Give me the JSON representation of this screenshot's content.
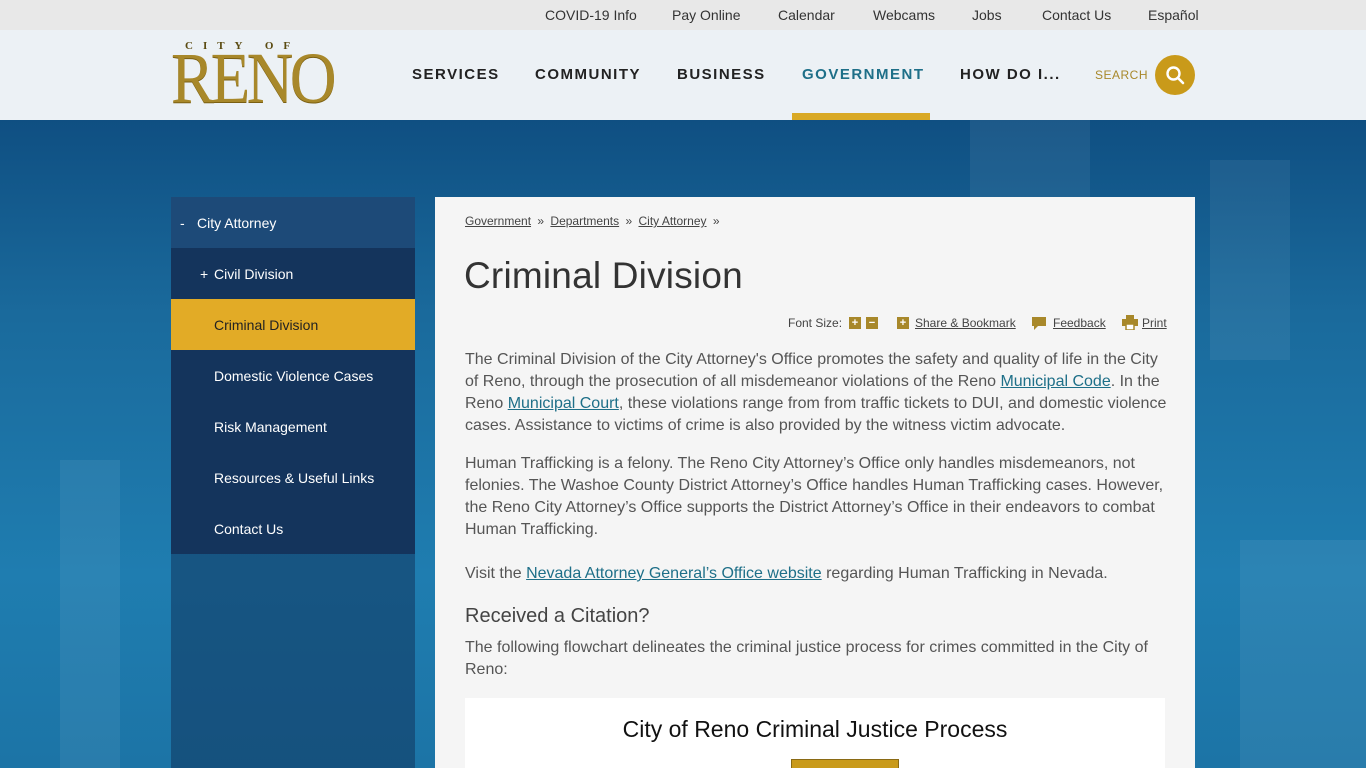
{
  "utility_links": [
    "COVID-19 Info",
    "Pay Online",
    "Calendar",
    "Webcams",
    "Jobs",
    "Contact Us",
    "Español"
  ],
  "logo": {
    "city_of": "CITY OF",
    "name": "RENO"
  },
  "nav": [
    {
      "label": "SERVICES"
    },
    {
      "label": "COMMUNITY"
    },
    {
      "label": "BUSINESS"
    },
    {
      "label": "GOVERNMENT",
      "active": true
    },
    {
      "label": "HOW DO I..."
    }
  ],
  "search": {
    "label": "SEARCH",
    "icon": "search-icon"
  },
  "sidenav": {
    "parent": {
      "symbol": "-",
      "label": "City Attorney"
    },
    "items": [
      {
        "symbol": "+",
        "label": "Civil Division"
      },
      {
        "symbol": "",
        "label": "Criminal Division",
        "active": true
      },
      {
        "symbol": "",
        "label": "Domestic Violence Cases"
      },
      {
        "symbol": "",
        "label": "Risk Management"
      },
      {
        "symbol": "",
        "label": "Resources & Useful Links"
      },
      {
        "symbol": "",
        "label": "Contact Us"
      }
    ]
  },
  "breadcrumb": [
    "Government",
    "Departments",
    "City Attorney"
  ],
  "breadcrumb_sep": "»",
  "page_title": "Criminal Division",
  "tools": {
    "font_size_label": "Font Size:",
    "share_label": "Share & Bookmark",
    "feedback_label": "Feedback",
    "print_label": "Print"
  },
  "body": {
    "p1_a": "The Criminal Division of the City Attorney's Office promotes the safety and quality of life in the City of Reno, through the prosecution of all misdemeanor violations of the Reno ",
    "p1_link1": "Municipal Code",
    "p1_b": ".  In the Reno ",
    "p1_link2": "Municipal Court",
    "p1_c": ", these violations range from from traffic tickets to DUI, and domestic violence cases. Assistance to victims of crime is also provided by the witness victim advocate.",
    "p2": "Human Trafficking is a felony.  The Reno City Attorney’s Office only handles misdemeanors, not felonies.  The Washoe County District Attorney’s Office handles Human Trafficking cases.  However, the Reno City Attorney’s Office supports the District Attorney’s Office in their endeavors to combat Human Trafficking.",
    "p3_a": "Visit the ",
    "p3_link": "Nevada Attorney General’s Office website",
    "p3_b": " regarding Human Trafficking in Nevada.",
    "subheading": "Received a Citation?",
    "p4": "The following flowchart delineates the criminal justice process for crimes committed in the City of Reno:",
    "flowchart_title": "City of Reno Criminal Justice Process"
  },
  "colors": {
    "gold": "#d9a925",
    "navy": "#14345c",
    "teal_link": "#1e6f88"
  }
}
